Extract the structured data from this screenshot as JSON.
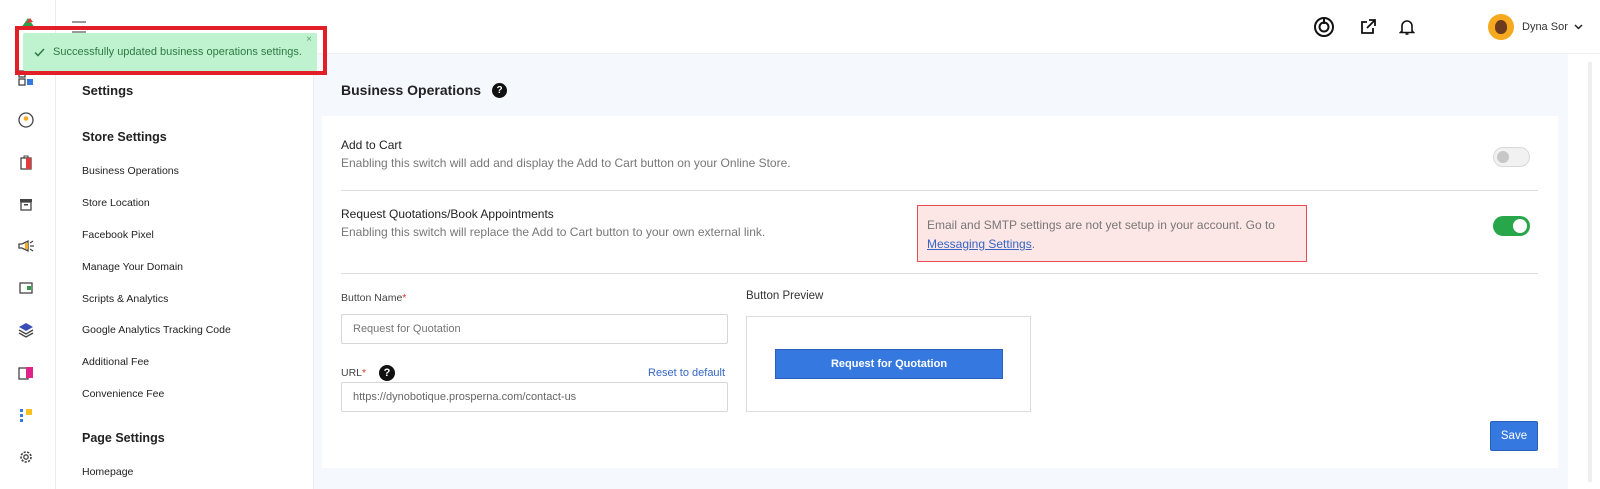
{
  "toast": {
    "message": "Successfully updated business operations settings.",
    "close": "×"
  },
  "topbar": {
    "user_name": "Dyna Sor"
  },
  "sidebar": {
    "title": "Settings",
    "store_section": "Store Settings",
    "store_items": [
      "Business Operations",
      "Store Location",
      "Facebook Pixel",
      "Manage Your Domain",
      "Scripts & Analytics",
      "Google Analytics Tracking Code",
      "Additional Fee",
      "Convenience Fee"
    ],
    "page_section": "Page Settings",
    "page_items": [
      "Homepage"
    ]
  },
  "main": {
    "title": "Business Operations",
    "add_to_cart": {
      "title": "Add to Cart",
      "description": "Enabling this switch will add and display the Add to Cart button on your Online Store.",
      "enabled": false
    },
    "request_quotations": {
      "title": "Request Quotations/Book Appointments",
      "description": "Enabling this switch will replace the Add to Cart button to your own external link.",
      "enabled": true
    },
    "alert": {
      "text": "Email and SMTP settings are not yet setup in your account. Go to",
      "link": "Messaging Settings",
      "tail": "."
    },
    "button_name": {
      "label": "Button Name",
      "placeholder": "Request for Quotation"
    },
    "url": {
      "label": "URL",
      "value": "https://dynobotique.prosperna.com/contact-us",
      "reset": "Reset to default"
    },
    "preview": {
      "label": "Button Preview",
      "button": "Request for Quotation"
    },
    "save": "Save"
  },
  "colors": {
    "primary": "#3579e0",
    "toggle_on": "#27a74a",
    "toast_bg": "#bff3cf",
    "alert_bg": "#fde6e6",
    "highlight": "#e21f26"
  }
}
